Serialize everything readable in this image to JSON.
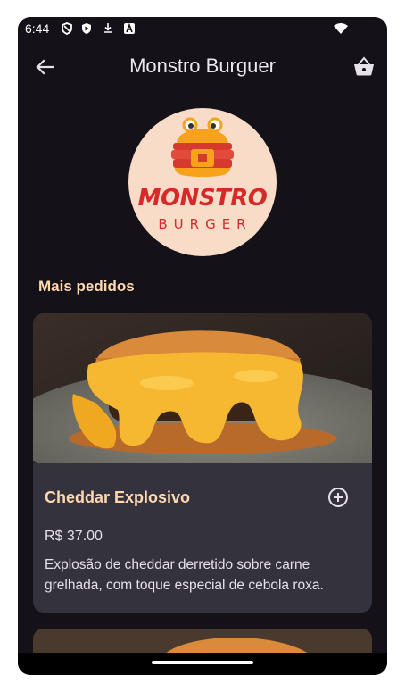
{
  "status_bar": {
    "time": "6:44",
    "icons": [
      "shield-icon",
      "play-protect-icon",
      "download-icon",
      "a-icon",
      "wifi-icon"
    ]
  },
  "app_bar": {
    "title": "Monstro Burguer",
    "back_icon": "arrow-back-icon",
    "cart_icon": "shopping-basket-icon"
  },
  "logo": {
    "main_text": "MONSTRO",
    "sub_text": "BURGER"
  },
  "section": {
    "title": "Mais pedidos"
  },
  "featured_item": {
    "name": "Cheddar Explosivo",
    "price": "R$ 37.00",
    "description": "Explosão de cheddar derretido sobre carne grelhada, com toque especial de cebola roxa.",
    "add_icon": "add-circle-icon"
  },
  "colors": {
    "background": "#141218",
    "card": "#34323c",
    "accent_text": "#ffd8b0",
    "logo_red": "#d42a2a"
  }
}
